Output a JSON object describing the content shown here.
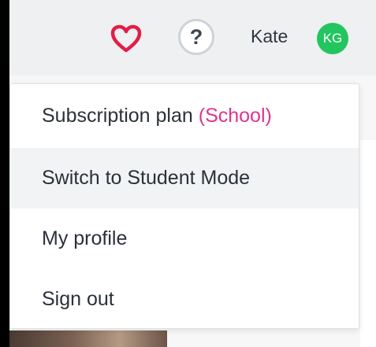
{
  "header": {
    "favorites_icon": "heart-icon",
    "help_label": "?",
    "user_name": "Kate",
    "avatar_initials": "KG",
    "colors": {
      "heart": "#e11d48",
      "avatar": "#22c55e"
    }
  },
  "menu": {
    "subscription_label": "Subscription plan",
    "subscription_plan": "(School)",
    "switch_mode_label": "Switch to Student Mode",
    "profile_label": "My profile",
    "sign_out_label": "Sign out",
    "accent_color": "#e1338f"
  }
}
